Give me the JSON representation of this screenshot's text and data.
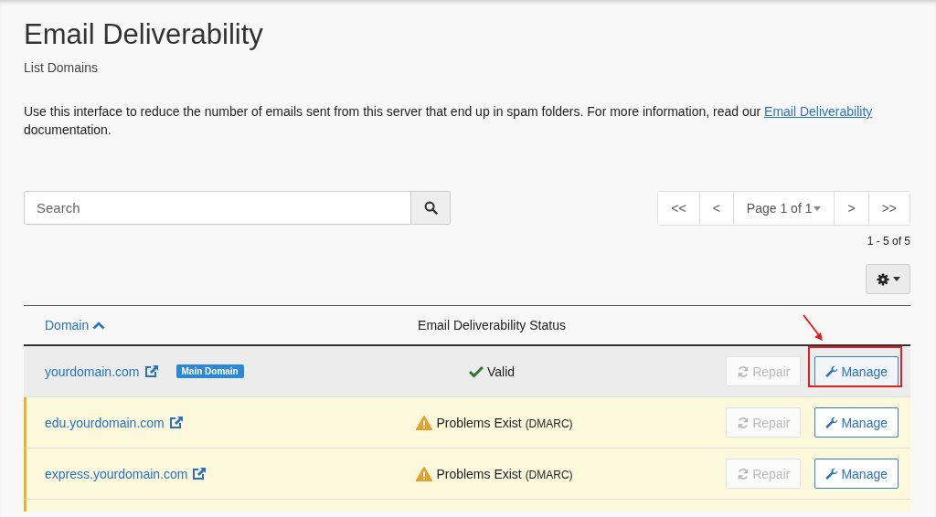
{
  "page": {
    "title": "Email Deliverability",
    "subtitle": "List Domains",
    "intro": "Use this interface to reduce the number of emails sent from this server that end up in spam folders. For more information, read our ",
    "intro_link": "Email Deliverability",
    "intro_end": " documentation."
  },
  "search": {
    "placeholder": "Search"
  },
  "pager": {
    "first": "<<",
    "prev": "<",
    "page": "Page 1 of 1",
    "next": ">",
    "last": ">>",
    "range": "1 - 5 of 5"
  },
  "table": {
    "columns": [
      {
        "label": "Domain",
        "sortable": true
      },
      {
        "label": "Email Deliverability Status",
        "sortable": false
      }
    ],
    "rows": [
      {
        "domain": "yourdomain.com",
        "badge": "Main Domain",
        "kind": "valid",
        "status": "Valid",
        "status_note": "",
        "highlighted": true,
        "repair": {
          "label": "Repair",
          "disabled": true
        },
        "manage": {
          "label": "Manage",
          "callout": true
        }
      },
      {
        "domain": "edu.yourdomain.com",
        "kind": "warning",
        "status": "Problems Exist",
        "status_note": "(DMARC)",
        "highlighted": false,
        "repair": {
          "label": "Repair",
          "disabled": true
        },
        "manage": {
          "label": "Manage",
          "callout": false
        }
      },
      {
        "domain": "express.yourdomain.com",
        "kind": "warning",
        "status": "Problems Exist",
        "status_note": "(DMARC)",
        "highlighted": false,
        "repair": {
          "label": "Repair",
          "disabled": true
        },
        "manage": {
          "label": "Manage",
          "callout": false
        }
      },
      {
        "kind": "warning",
        "partial": true
      }
    ]
  }
}
